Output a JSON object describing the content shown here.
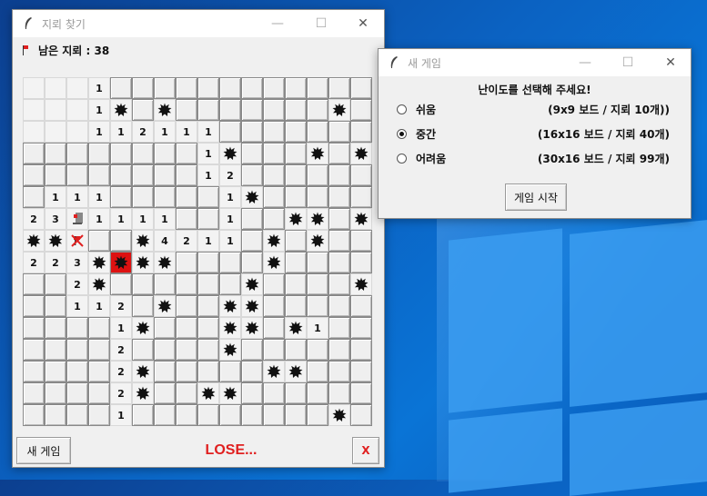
{
  "main_window": {
    "title": "지뢰 찾기",
    "min_glyph": "—",
    "max_glyph": "☐",
    "close_glyph": "✕",
    "mines_left_label": "남은 지뢰 : 38",
    "board": [
      "H   1 HHHHHHHHHH",
      "   1 MHMHHHHHMH",
      "   11 2 1 1 1HHHHHH",
      "HHHHHHHHH1MHHMHM",
      "HHHHHHHHH12HHHHH",
      "H111HHHHH1MHHHHH",
      "23?1111HH1HMMHMH",
      "MMXHHM421 1HMHMHH",
      "223MB MMHHHHMHHH",
      "HH2MHHHHHHMHHHHM",
      "HH112HMHHMMHHHHH",
      "HHHH1MHHHMMHM1HH",
      "HHHH2HHHHMHHHHHH",
      "HHHH2MHHHHHMMHHH",
      "HHHH2MHHMMHHHHHH",
      "HHHH1HHHHHHHHHMH"
    ],
    "rows": [
      [
        "O",
        "O",
        "O",
        "1",
        "H",
        "H",
        "H",
        "H",
        "H",
        "H",
        "H",
        "H",
        "H",
        "H",
        "H",
        "H"
      ],
      [
        "O",
        "O",
        "O",
        "1",
        "M",
        "H",
        "M",
        "H",
        "H",
        "H",
        "H",
        "H",
        "H",
        "H",
        "M",
        "H"
      ],
      [
        "O",
        "O",
        "O",
        "1",
        "1",
        "2",
        "1",
        "1",
        "1",
        "H",
        "H",
        "H",
        "H",
        "H",
        "H",
        "H"
      ],
      [
        "H",
        "H",
        "H",
        "H",
        "H",
        "H",
        "H",
        "H",
        "1",
        "M",
        "H",
        "H",
        "H",
        "M",
        "H",
        "M"
      ],
      [
        "H",
        "H",
        "H",
        "H",
        "H",
        "H",
        "H",
        "H",
        "1",
        "2",
        "H",
        "H",
        "H",
        "H",
        "H",
        "H"
      ],
      [
        "H",
        "1",
        "1",
        "1",
        "H",
        "H",
        "H",
        "H",
        "H",
        "1",
        "M",
        "H",
        "H",
        "H",
        "H",
        "H"
      ],
      [
        "2",
        "3",
        "F",
        "1",
        "1",
        "1",
        "1",
        "H",
        "H",
        "1",
        "H",
        "H",
        "M",
        "M",
        "H",
        "M"
      ],
      [
        "M",
        "M",
        "X",
        "H",
        "H",
        "M",
        "4",
        "2",
        "1",
        "1",
        "H",
        "M",
        "H",
        "M",
        "H",
        "H"
      ],
      [
        "2",
        "2",
        "3",
        "M",
        "B",
        "M",
        "M",
        "H",
        "H",
        "H",
        "H",
        "M",
        "H",
        "H",
        "H",
        "H"
      ],
      [
        "H",
        "H",
        "2",
        "M",
        "H",
        "H",
        "H",
        "H",
        "H",
        "H",
        "M",
        "H",
        "H",
        "H",
        "H",
        "M"
      ],
      [
        "H",
        "H",
        "1",
        "1",
        "2",
        "H",
        "M",
        "H",
        "H",
        "M",
        "M",
        "H",
        "H",
        "H",
        "H",
        "H"
      ],
      [
        "H",
        "H",
        "H",
        "H",
        "1",
        "M",
        "H",
        "H",
        "H",
        "M",
        "M",
        "H",
        "M",
        "1",
        "H",
        "H"
      ],
      [
        "H",
        "H",
        "H",
        "H",
        "2",
        "H",
        "H",
        "H",
        "H",
        "M",
        "H",
        "H",
        "H",
        "H",
        "H",
        "H"
      ],
      [
        "H",
        "H",
        "H",
        "H",
        "2",
        "M",
        "H",
        "H",
        "H",
        "H",
        "H",
        "M",
        "M",
        "H",
        "H",
        "H"
      ],
      [
        "H",
        "H",
        "H",
        "H",
        "2",
        "M",
        "H",
        "H",
        "M",
        "M",
        "H",
        "H",
        "H",
        "H",
        "H",
        "H"
      ],
      [
        "H",
        "H",
        "H",
        "H",
        "1",
        "H",
        "H",
        "H",
        "H",
        "H",
        "H",
        "H",
        "H",
        "H",
        "M",
        "H"
      ]
    ],
    "new_game_button": "새 게임",
    "result_text": "LOSE...",
    "exit_button": "X",
    "colors": {
      "result": "#e02020",
      "exploded": "#dd1111"
    }
  },
  "dialog": {
    "title": "새 게임",
    "min_glyph": "—",
    "max_glyph": "☐",
    "close_glyph": "✕",
    "heading": "난이도를 선택해 주세요!",
    "options": [
      {
        "label": "쉬움",
        "desc": "(9x9 보드 / 지뢰 10개))",
        "selected": false
      },
      {
        "label": "중간",
        "desc": "(16x16 보드 / 지뢰 40개)",
        "selected": true
      },
      {
        "label": "어려움",
        "desc": "(30x16 보드 / 지뢰 99개)",
        "selected": false
      }
    ],
    "start_button": "게임 시작"
  }
}
